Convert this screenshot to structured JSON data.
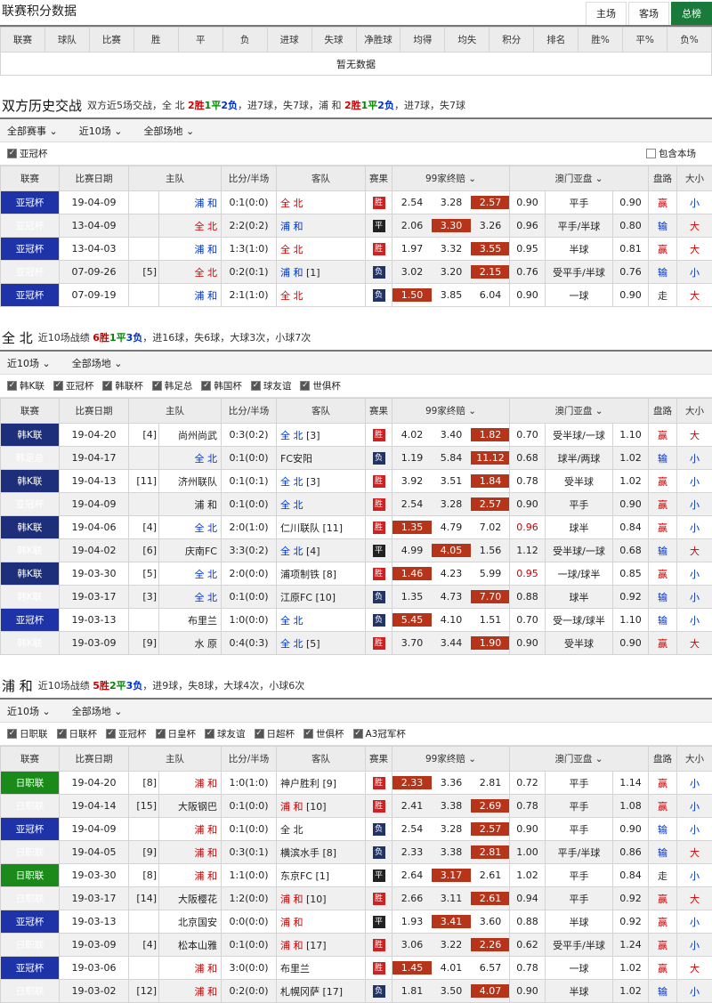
{
  "league_table": {
    "title": "联赛积分数据",
    "tabs": [
      "主场",
      "客场",
      "总榜"
    ],
    "headers": [
      "联赛",
      "球队",
      "比赛",
      "胜",
      "平",
      "负",
      "进球",
      "失球",
      "净胜球",
      "均得",
      "均失",
      "积分",
      "排名",
      "胜%",
      "平%",
      "负%"
    ],
    "empty": "暂无数据"
  },
  "h2h": {
    "title": "双方历史交战",
    "summary_prefix": "双方近5场交战，",
    "team1": "全  北",
    "t1_w": "2胜",
    "t1_d": "1平",
    "t1_l": "2负",
    "t1_rest": "，进7球，失7球，",
    "team2": "浦  和",
    "t2_w": "2胜",
    "t2_d": "1平",
    "t2_l": "2负",
    "t2_rest": "，进7球，失7球",
    "filters": [
      "全部赛事",
      "近10场",
      "全部场地"
    ],
    "checks": [
      {
        "label": "亚冠杯",
        "on": true
      }
    ],
    "include_label": "包含本场"
  },
  "cols": {
    "league": "联赛",
    "date": "比赛日期",
    "home": "主队",
    "score": "比分/半场",
    "away": "客队",
    "result": "赛果",
    "odds": "99家终赔",
    "asian": "澳门亚盘",
    "pan": "盘路",
    "dx": "大小"
  },
  "jeonbuk": {
    "title": "全  北",
    "summary_prefix": "近10场战绩 ",
    "w": "6胜",
    "d": "1平",
    "l": "3负",
    "rest": "，进16球，失6球，大球3次，小球7次",
    "filters": [
      "近10场",
      "全部场地"
    ],
    "checks": [
      "韩K联",
      "亚冠杯",
      "韩联杯",
      "韩足总",
      "韩国杯",
      "球友谊",
      "世俱杯"
    ]
  },
  "urawa": {
    "title": "浦  和",
    "summary_prefix": "近10场战绩 ",
    "w": "5胜",
    "d": "2平",
    "l": "3负",
    "rest": "，进9球，失8球，大球4次，小球6次",
    "filters": [
      "近10场",
      "全部场地"
    ],
    "checks": [
      "日职联",
      "日联杯",
      "亚冠杯",
      "日皇杯",
      "球友谊",
      "日超杯",
      "世俱杯",
      "A3冠军杯"
    ]
  },
  "h2h_rows": [
    [
      "亚冠杯",
      "acl",
      "19-04-09",
      "",
      "浦  和",
      "0:1(0:0)",
      "全  北",
      "",
      "胜",
      "w",
      "2.54",
      "3.28",
      "2.57",
      2,
      "0.90",
      "平手",
      "0.90",
      "赢",
      "小",
      0,
      1
    ],
    [
      "亚冠杯",
      "acl",
      "13-04-09",
      "",
      "全  北",
      "2:2(0:2)",
      "浦  和",
      "",
      "平",
      "d",
      "2.06",
      "3.30",
      "3.26",
      1,
      "0.96",
      "平手/半球",
      "0.80",
      "输",
      "大",
      1,
      0
    ],
    [
      "亚冠杯",
      "acl",
      "13-04-03",
      "",
      "浦  和",
      "1:3(1:0)",
      "全  北",
      "",
      "胜",
      "w",
      "1.97",
      "3.32",
      "3.55",
      2,
      "0.95",
      "半球",
      "0.81",
      "赢",
      "大",
      0,
      1
    ],
    [
      "亚冠杯",
      "acl",
      "07-09-26",
      "[5]",
      "全  北",
      "0:2(0:1)",
      "浦  和",
      "[1]",
      "负",
      "l",
      "3.02",
      "3.20",
      "2.15",
      2,
      "0.76",
      "受平手/半球",
      "0.76",
      "输",
      "小",
      1,
      0
    ],
    [
      "亚冠杯",
      "acl",
      "07-09-19",
      "",
      "浦  和",
      "2:1(1:0)",
      "全  北",
      "",
      "负",
      "l",
      "1.50",
      "3.85",
      "6.04",
      0,
      "0.90",
      "一球",
      "0.90",
      "走",
      "大",
      0,
      1
    ]
  ],
  "jb_rows": [
    [
      "韩K联",
      "kl",
      "19-04-20",
      "[4]",
      "尚州尚武",
      "0:3(0:2)",
      "全  北",
      "[3]",
      "胜",
      "w",
      "4.02",
      "3.40",
      "1.82",
      2,
      "0.70",
      "受半球/一球",
      "1.10",
      "赢",
      "大",
      0,
      1
    ],
    [
      "韩足总",
      "kf",
      "19-04-17",
      "",
      "全  北",
      "0:1(0:0)",
      "FC安阳",
      "",
      "负",
      "l",
      "1.19",
      "5.84",
      "11.12",
      2,
      "0.68",
      "球半/两球",
      "1.02",
      "输",
      "小",
      1,
      0
    ],
    [
      "韩K联",
      "kl",
      "19-04-13",
      "[11]",
      "济州联队",
      "0:1(0:1)",
      "全  北",
      "[3]",
      "胜",
      "w",
      "3.92",
      "3.51",
      "1.84",
      2,
      "0.78",
      "受半球",
      "1.02",
      "赢",
      "小",
      0,
      1
    ],
    [
      "亚冠杯",
      "acl",
      "19-04-09",
      "",
      "浦  和",
      "0:1(0:0)",
      "全  北",
      "",
      "胜",
      "w",
      "2.54",
      "3.28",
      "2.57",
      2,
      "0.90",
      "平手",
      "0.90",
      "赢",
      "小",
      0,
      1
    ],
    [
      "韩K联",
      "kl",
      "19-04-06",
      "[4]",
      "全  北",
      "2:0(1:0)",
      "仁川联队",
      "[11]",
      "胜",
      "w",
      "1.35",
      "4.79",
      "7.02",
      0,
      "0.96",
      "球半",
      "0.84",
      "赢",
      "小",
      1,
      0
    ],
    [
      "韩K联",
      "kl",
      "19-04-02",
      "[6]",
      "庆南FC",
      "3:3(0:2)",
      "全  北",
      "[4]",
      "平",
      "d",
      "4.99",
      "4.05",
      "1.56",
      1,
      "1.12",
      "受半球/一球",
      "0.68",
      "输",
      "大",
      0,
      1
    ],
    [
      "韩K联",
      "kl",
      "19-03-30",
      "[5]",
      "全  北",
      "2:0(0:0)",
      "浦项制铁",
      "[8]",
      "胜",
      "w",
      "1.46",
      "4.23",
      "5.99",
      0,
      "0.95",
      "一球/球半",
      "0.85",
      "赢",
      "小",
      1,
      0
    ],
    [
      "韩K联",
      "kl",
      "19-03-17",
      "[3]",
      "全  北",
      "0:1(0:0)",
      "江原FC",
      "[10]",
      "负",
      "l",
      "1.35",
      "4.73",
      "7.70",
      2,
      "0.88",
      "球半",
      "0.92",
      "输",
      "小",
      1,
      0
    ],
    [
      "亚冠杯",
      "acl",
      "19-03-13",
      "",
      "布里兰",
      "1:0(0:0)",
      "全  北",
      "",
      "负",
      "l",
      "5.45",
      "4.10",
      "1.51",
      0,
      "0.70",
      "受一球/球半",
      "1.10",
      "输",
      "小",
      0,
      1
    ],
    [
      "韩K联",
      "kl",
      "19-03-09",
      "[9]",
      "水  原",
      "0:4(0:3)",
      "全  北",
      "[5]",
      "胜",
      "w",
      "3.70",
      "3.44",
      "1.90",
      2,
      "0.90",
      "受半球",
      "0.90",
      "赢",
      "大",
      0,
      1
    ]
  ],
  "ur_rows": [
    [
      "日职联",
      "jl",
      "19-04-20",
      "[8]",
      "浦  和",
      "1:0(1:0)",
      "神户胜利",
      "[9]",
      "胜",
      "w",
      "2.33",
      "3.36",
      "2.81",
      0,
      "0.72",
      "平手",
      "1.14",
      "赢",
      "小",
      1,
      0
    ],
    [
      "日职联",
      "jl",
      "19-04-14",
      "[15]",
      "大阪钢巴",
      "0:1(0:0)",
      "浦  和",
      "[10]",
      "胜",
      "w",
      "2.41",
      "3.38",
      "2.69",
      2,
      "0.78",
      "平手",
      "1.08",
      "赢",
      "小",
      0,
      1
    ],
    [
      "亚冠杯",
      "acl",
      "19-04-09",
      "",
      "浦  和",
      "0:1(0:0)",
      "全  北",
      "",
      "负",
      "l",
      "2.54",
      "3.28",
      "2.57",
      2,
      "0.90",
      "平手",
      "0.90",
      "输",
      "小",
      1,
      0
    ],
    [
      "日职联",
      "jl",
      "19-04-05",
      "[9]",
      "浦  和",
      "0:3(0:1)",
      "横滨水手",
      "[8]",
      "负",
      "l",
      "2.33",
      "3.38",
      "2.81",
      2,
      "1.00",
      "平手/半球",
      "0.86",
      "输",
      "大",
      1,
      0
    ],
    [
      "日职联",
      "jl",
      "19-03-30",
      "[8]",
      "浦  和",
      "1:1(0:0)",
      "东京FC",
      "[1]",
      "平",
      "d",
      "2.64",
      "3.17",
      "2.61",
      1,
      "1.02",
      "平手",
      "0.84",
      "走",
      "小",
      1,
      0
    ],
    [
      "日职联",
      "jl",
      "19-03-17",
      "[14]",
      "大阪樱花",
      "1:2(0:0)",
      "浦  和",
      "[10]",
      "胜",
      "w",
      "2.66",
      "3.11",
      "2.61",
      2,
      "0.94",
      "平手",
      "0.92",
      "赢",
      "大",
      0,
      1
    ],
    [
      "亚冠杯",
      "acl",
      "19-03-13",
      "",
      "北京国安",
      "0:0(0:0)",
      "浦  和",
      "",
      "平",
      "d",
      "1.93",
      "3.41",
      "3.60",
      1,
      "0.88",
      "半球",
      "0.92",
      "赢",
      "小",
      0,
      1
    ],
    [
      "日职联",
      "jl",
      "19-03-09",
      "[4]",
      "松本山雅",
      "0:1(0:0)",
      "浦  和",
      "[17]",
      "胜",
      "w",
      "3.06",
      "3.22",
      "2.26",
      2,
      "0.62",
      "受平手/半球",
      "1.24",
      "赢",
      "小",
      0,
      1
    ],
    [
      "亚冠杯",
      "acl",
      "19-03-06",
      "",
      "浦  和",
      "3:0(0:0)",
      "布里兰",
      "",
      "胜",
      "w",
      "1.45",
      "4.01",
      "6.57",
      0,
      "0.78",
      "一球",
      "1.02",
      "赢",
      "大",
      1,
      0
    ],
    [
      "日职联",
      "jl",
      "19-03-02",
      "[12]",
      "浦  和",
      "0:2(0:0)",
      "札幌冈萨",
      "[17]",
      "负",
      "l",
      "1.81",
      "3.50",
      "4.07",
      2,
      "0.90",
      "半球",
      "1.02",
      "输",
      "小",
      1,
      0
    ]
  ]
}
